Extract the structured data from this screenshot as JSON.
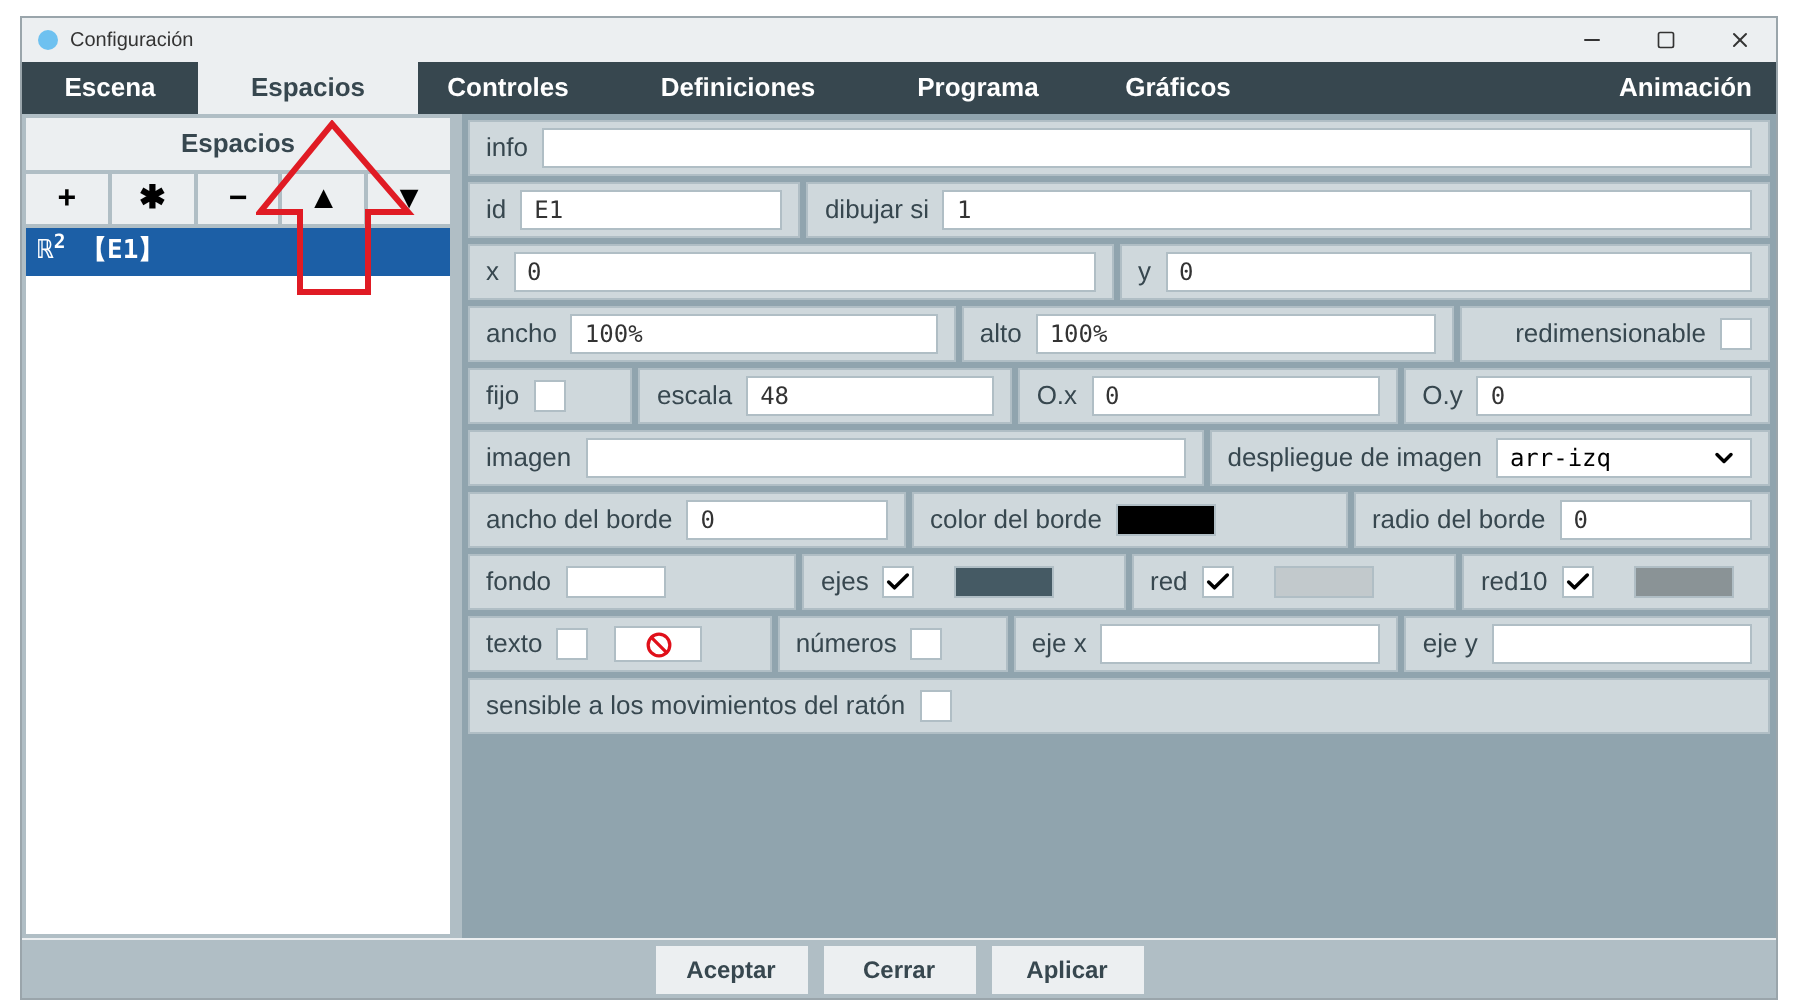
{
  "window": {
    "title": "Configuración"
  },
  "tabs": [
    {
      "label": "Escena",
      "selected": false
    },
    {
      "label": "Espacios",
      "selected": true
    },
    {
      "label": "Controles",
      "selected": false
    },
    {
      "label": "Definiciones",
      "selected": false
    },
    {
      "label": "Programa",
      "selected": false
    },
    {
      "label": "Gráficos",
      "selected": false
    },
    {
      "label": "Animación",
      "selected": false
    }
  ],
  "sidebar": {
    "title": "Espacios",
    "tools": [
      "+",
      "✱",
      "−",
      "▲",
      "▼"
    ],
    "items": [
      {
        "label": "ℝ$^{2}$ 【E1】",
        "selected": true
      }
    ]
  },
  "form": {
    "fields": [
      {
        "kind": "input",
        "label": "info"
      },
      {
        "kind": "input",
        "label": "id",
        "value": "E1"
      },
      {
        "kind": "input",
        "label": "dibujar si",
        "value": "1"
      },
      {
        "kind": "input",
        "label": "x",
        "value": "0"
      },
      {
        "kind": "input",
        "label": "y",
        "value": "0"
      },
      {
        "kind": "input",
        "label": "ancho",
        "value": "100%"
      },
      {
        "kind": "input",
        "label": "alto",
        "value": "100%"
      },
      {
        "kind": "checkbox",
        "label": "redimensionable",
        "checked": false
      },
      {
        "kind": "checkbox",
        "label": "fijo",
        "checked": false
      },
      {
        "kind": "input",
        "label": "escala",
        "value": "48"
      },
      {
        "kind": "input",
        "label": "O.x",
        "value": "0"
      },
      {
        "kind": "input",
        "label": "O.y",
        "value": "0"
      },
      {
        "kind": "input",
        "label": "imagen"
      },
      {
        "kind": "select",
        "label": "despliegue de imagen",
        "value": "arr-izq"
      },
      {
        "kind": "input",
        "label": "ancho del borde",
        "value": "0"
      },
      {
        "kind": "color",
        "label": "color del borde",
        "color": "#000000"
      },
      {
        "kind": "input",
        "label": "radio del borde",
        "value": "0"
      },
      {
        "kind": "color",
        "label": "fondo",
        "color": "#ffffff"
      },
      {
        "kind": "check_color",
        "label": "ejes",
        "checked": true,
        "color": "#455a64"
      },
      {
        "kind": "check_color",
        "label": "red",
        "checked": true,
        "color": "#c2c9cc"
      },
      {
        "kind": "check_color",
        "label": "red10",
        "checked": true,
        "color": "#8a9396"
      },
      {
        "kind": "check_button",
        "label": "texto",
        "checked": false
      },
      {
        "kind": "checkbox",
        "label": "números",
        "checked": false
      },
      {
        "kind": "input",
        "label": "eje x"
      },
      {
        "kind": "input",
        "label": "eje y"
      },
      {
        "kind": "checkbox",
        "label": "sensible a los movimientos del ratón",
        "checked": false
      }
    ]
  },
  "buttons": [
    "Aceptar",
    "Cerrar",
    "Aplicar"
  ]
}
